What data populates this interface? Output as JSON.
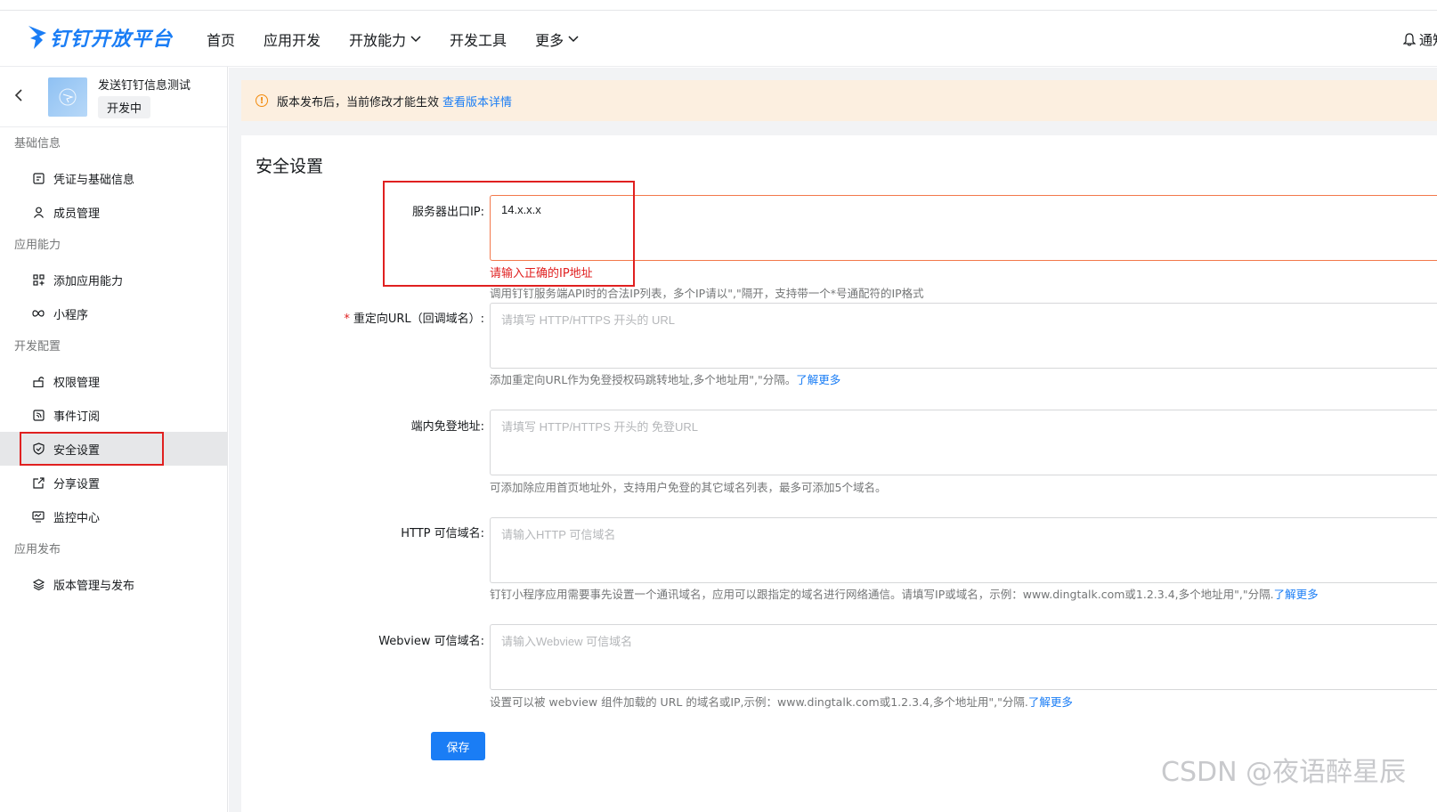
{
  "header": {
    "logo_text": "钉钉开放平台",
    "nav": [
      {
        "label": "首页",
        "dropdown": false
      },
      {
        "label": "应用开发",
        "dropdown": false
      },
      {
        "label": "开放能力",
        "dropdown": true
      },
      {
        "label": "开发工具",
        "dropdown": false
      },
      {
        "label": "更多",
        "dropdown": true
      }
    ],
    "notify_label": "通知"
  },
  "sidebar": {
    "app_name": "发送钉钉信息测试",
    "app_status": "开发中",
    "groups": [
      {
        "title": "基础信息",
        "items": [
          {
            "label": "凭证与基础信息",
            "icon": "credential-icon"
          },
          {
            "label": "成员管理",
            "icon": "user-icon"
          }
        ]
      },
      {
        "title": "应用能力",
        "items": [
          {
            "label": "添加应用能力",
            "icon": "grid-add-icon"
          },
          {
            "label": "小程序",
            "icon": "infinity-icon"
          }
        ]
      },
      {
        "title": "开发配置",
        "items": [
          {
            "label": "权限管理",
            "icon": "unlock-icon"
          },
          {
            "label": "事件订阅",
            "icon": "rss-icon"
          },
          {
            "label": "安全设置",
            "icon": "shield-icon",
            "active": true
          },
          {
            "label": "分享设置",
            "icon": "share-icon"
          },
          {
            "label": "监控中心",
            "icon": "monitor-icon"
          }
        ]
      },
      {
        "title": "应用发布",
        "items": [
          {
            "label": "版本管理与发布",
            "icon": "layers-icon"
          }
        ]
      }
    ]
  },
  "notice": {
    "text": "版本发布后，当前修改才能生效",
    "link": "查看版本详情"
  },
  "panel": {
    "title": "安全设置",
    "fields": {
      "ip": {
        "label": "服务器出口IP:",
        "value": "14.x.x.x",
        "error": "请输入正确的IP地址",
        "hint": "调用钉钉服务端API时的合法IP列表，多个IP请以\",\"隔开，支持带一个*号通配符的IP格式"
      },
      "redirect": {
        "required_mark": "*",
        "label": "重定向URL（回调域名）:",
        "placeholder": "请填写 HTTP/HTTPS 开头的 URL",
        "hint": "添加重定向URL作为免登授权码跳转地址,多个地址用\",\"分隔。",
        "hint_link": "了解更多"
      },
      "sso": {
        "label": "端内免登地址:",
        "placeholder": "请填写 HTTP/HTTPS 开头的 免登URL",
        "hint": "可添加除应用首页地址外，支持用户免登的其它域名列表，最多可添加5个域名。"
      },
      "http": {
        "label": "HTTP 可信域名:",
        "placeholder": "请输入HTTP 可信域名",
        "hint": "钉钉小程序应用需要事先设置一个通讯域名，应用可以跟指定的域名进行网络通信。请填写IP或域名，示例：www.dingtalk.com或1.2.3.4,多个地址用\",\"分隔.",
        "hint_link": "了解更多"
      },
      "webview": {
        "label": "Webview 可信域名:",
        "placeholder": "请输入Webview 可信域名",
        "hint": "设置可以被 webview 组件加载的 URL 的域名或IP,示例：www.dingtalk.com或1.2.3.4,多个地址用\",\"分隔.",
        "hint_link": "了解更多"
      }
    },
    "save_label": "保存"
  },
  "watermark": "CSDN @夜语醉星辰",
  "colors": {
    "brand": "#1a7df5",
    "error": "#e02020",
    "notice_bg": "#fcefe0"
  }
}
